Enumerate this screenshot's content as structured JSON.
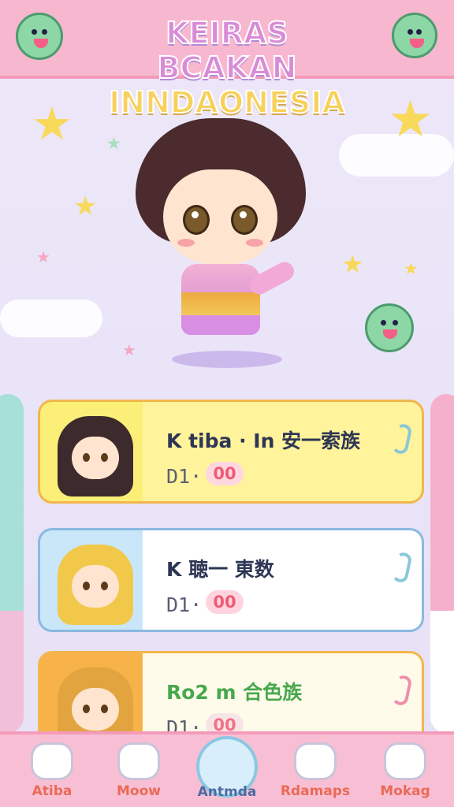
{
  "app": {
    "title_line_1": "KEIRAS BCAKAN",
    "title_line_2": "INNDAONESIA"
  },
  "character_cards": [
    {
      "name": "K tiba · In 安一索族",
      "level_label": "D1·",
      "level_value": "00"
    },
    {
      "name": "K 聴一 東数",
      "level_label": "D1·",
      "level_value": "00"
    },
    {
      "name": "Ro2 m 合色族",
      "level_label": "D1·",
      "level_value": "00"
    }
  ],
  "nav": [
    {
      "label": "Atiba",
      "icon": "home-icon"
    },
    {
      "label": "Moow",
      "icon": "shop-basket-icon"
    },
    {
      "label": "Antmda",
      "icon": "avatar-icon",
      "active": true
    },
    {
      "label": "Rdamaps",
      "icon": "character-icon"
    },
    {
      "label": "Mokag",
      "icon": "mascot-icon"
    }
  ],
  "colors": {
    "header": "#f7b8cf",
    "background": "#e9e4f6",
    "accent_blue": "#8bc7e2",
    "accent_pink": "#f49bbb",
    "accent_yellow": "#f7d15b"
  },
  "icons": [
    "star-icon",
    "cloud-icon",
    "sparkle-icon",
    "mascot-icon"
  ]
}
